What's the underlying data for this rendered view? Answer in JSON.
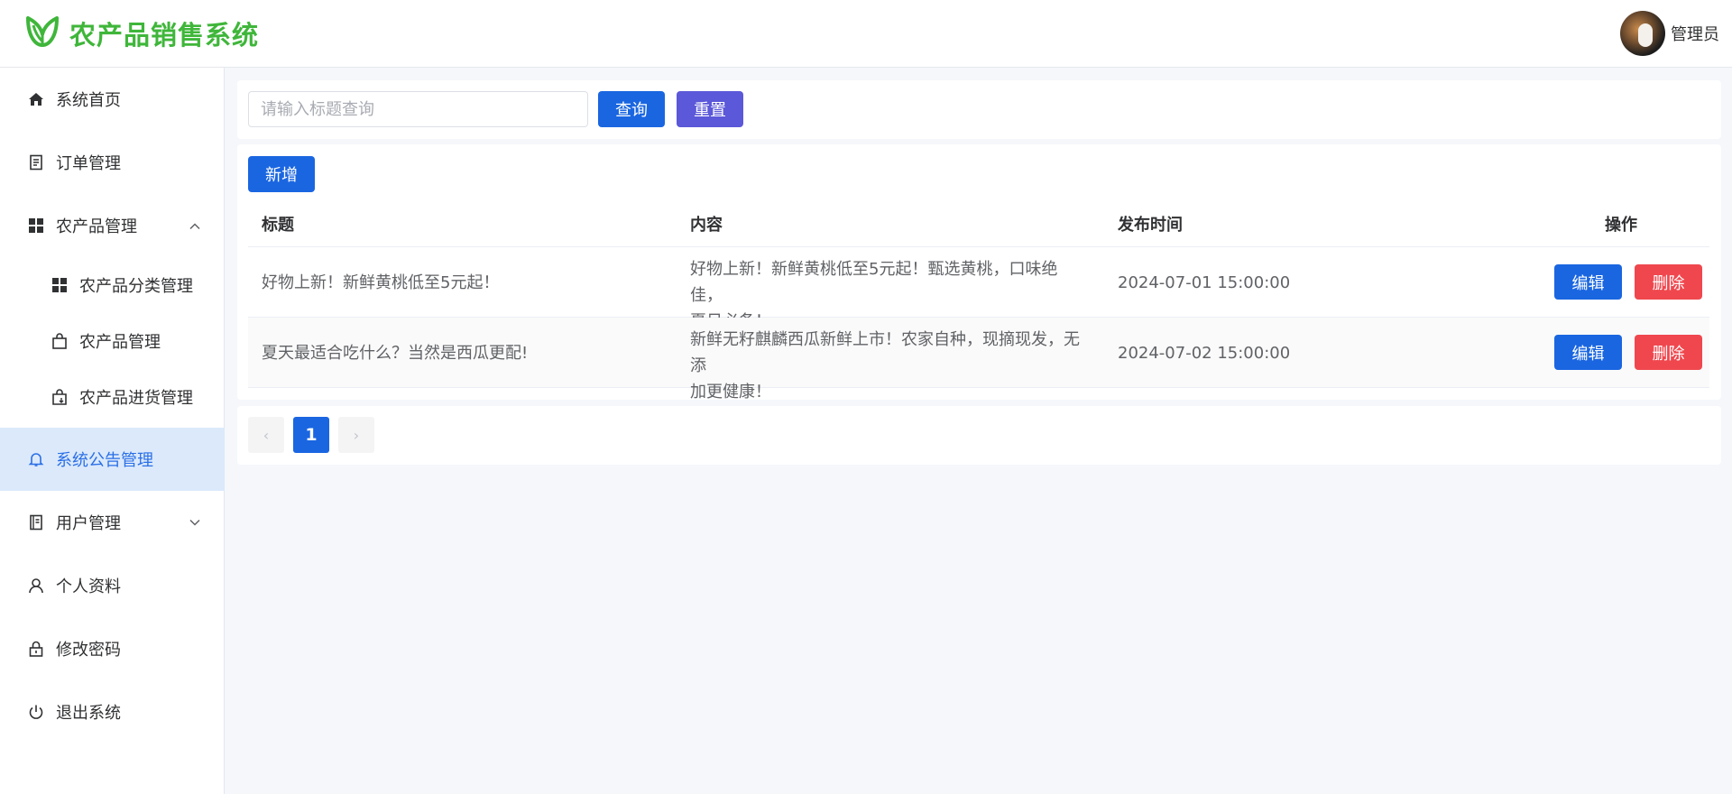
{
  "app": {
    "title": "农产品销售系统"
  },
  "header": {
    "user_name": "管理员"
  },
  "sidebar": {
    "items": [
      {
        "label": "系统首页",
        "icon": "home-icon"
      },
      {
        "label": "订单管理",
        "icon": "document-icon"
      },
      {
        "label": "农产品管理",
        "icon": "grid-icon",
        "expanded": true
      },
      {
        "label": "农产品分类管理",
        "icon": "grid-icon"
      },
      {
        "label": "农产品管理",
        "icon": "bag-icon"
      },
      {
        "label": "农产品进货管理",
        "icon": "bag-download-icon"
      },
      {
        "label": "系统公告管理",
        "icon": "bell-icon",
        "active": true
      },
      {
        "label": "用户管理",
        "icon": "notebook-icon",
        "expanded": false
      },
      {
        "label": "个人资料",
        "icon": "user-icon"
      },
      {
        "label": "修改密码",
        "icon": "lock-icon"
      },
      {
        "label": "退出系统",
        "icon": "power-icon"
      }
    ]
  },
  "search": {
    "placeholder": "请输入标题查询",
    "query_label": "查询",
    "reset_label": "重置"
  },
  "toolbar": {
    "add_label": "新增"
  },
  "table": {
    "headers": [
      "标题",
      "内容",
      "发布时间",
      "操作"
    ],
    "rows": [
      {
        "title": "好物上新！新鲜黄桃低至5元起！",
        "content_line1": "好物上新！新鲜黄桃低至5元起！甄选黄桃，口味绝佳，",
        "content_line2": "夏日必备！",
        "time": "2024-07-01 15:00:00",
        "edit": "编辑",
        "delete": "删除"
      },
      {
        "title": "夏天最适合吃什么？当然是西瓜更配!",
        "content_line1": "新鲜无籽麒麟西瓜新鲜上市！农家自种，现摘现发，无添",
        "content_line2": "加更健康！",
        "time": "2024-07-02 15:00:00",
        "edit": "编辑",
        "delete": "删除"
      }
    ]
  },
  "pagination": {
    "current_page": "1",
    "prev": "‹",
    "next": "›"
  },
  "colors": {
    "brand": "#3fb63a",
    "primary": "#1a66e1",
    "reset": "#5b58d9",
    "danger": "#f0474e",
    "active_bg": "#dbe9fb"
  }
}
